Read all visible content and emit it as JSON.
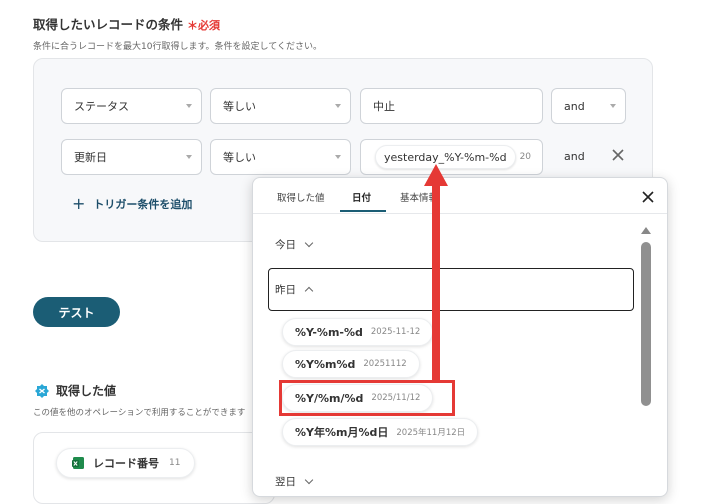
{
  "header": {
    "title": "取得したいレコードの条件",
    "required_mark": "＊",
    "required_label": "必須",
    "description": "条件に合うレコードを最大10行取得します。条件を設定してください。"
  },
  "conditions": [
    {
      "field": "ステータス",
      "operator": "等しい",
      "value": "中止",
      "joiner": "and"
    },
    {
      "field": "更新日",
      "operator": "等しい",
      "value": "yesterday_%Y-%m-%d",
      "value_suffix": "20",
      "joiner": "and"
    }
  ],
  "add_trigger_label": "トリガー条件を追加",
  "test_button_label": "テスト",
  "acquired": {
    "title": "取得した値",
    "description": "この値を他のオペレーションで利用することができます",
    "items": [
      {
        "label": "レコード番号",
        "value": "11"
      }
    ]
  },
  "popup": {
    "tabs": [
      {
        "label": "取得した値",
        "active": false
      },
      {
        "label": "日付",
        "active": true
      },
      {
        "label": "基本情報",
        "active": false
      }
    ],
    "sections": {
      "today": "今日",
      "yesterday": "昨日",
      "tomorrow": "翌日"
    },
    "formats": [
      {
        "format": "%Y-%m-%d",
        "example": "2025-11-12"
      },
      {
        "format": "%Y%m%d",
        "example": "20251112"
      },
      {
        "format": "%Y/%m/%d",
        "example": "2025/11/12",
        "highlighted": true
      },
      {
        "format": "%Y年%m月%d日",
        "example": "2025年11月12日"
      }
    ]
  },
  "colors": {
    "accent": "#1b5d75",
    "highlight": "#e53935",
    "required": "#e53935"
  },
  "icons": [
    "close-icon",
    "chevron-down-icon",
    "chevron-up-icon",
    "plus-icon",
    "sheet-icon",
    "badge-icon",
    "arrow-icon"
  ]
}
